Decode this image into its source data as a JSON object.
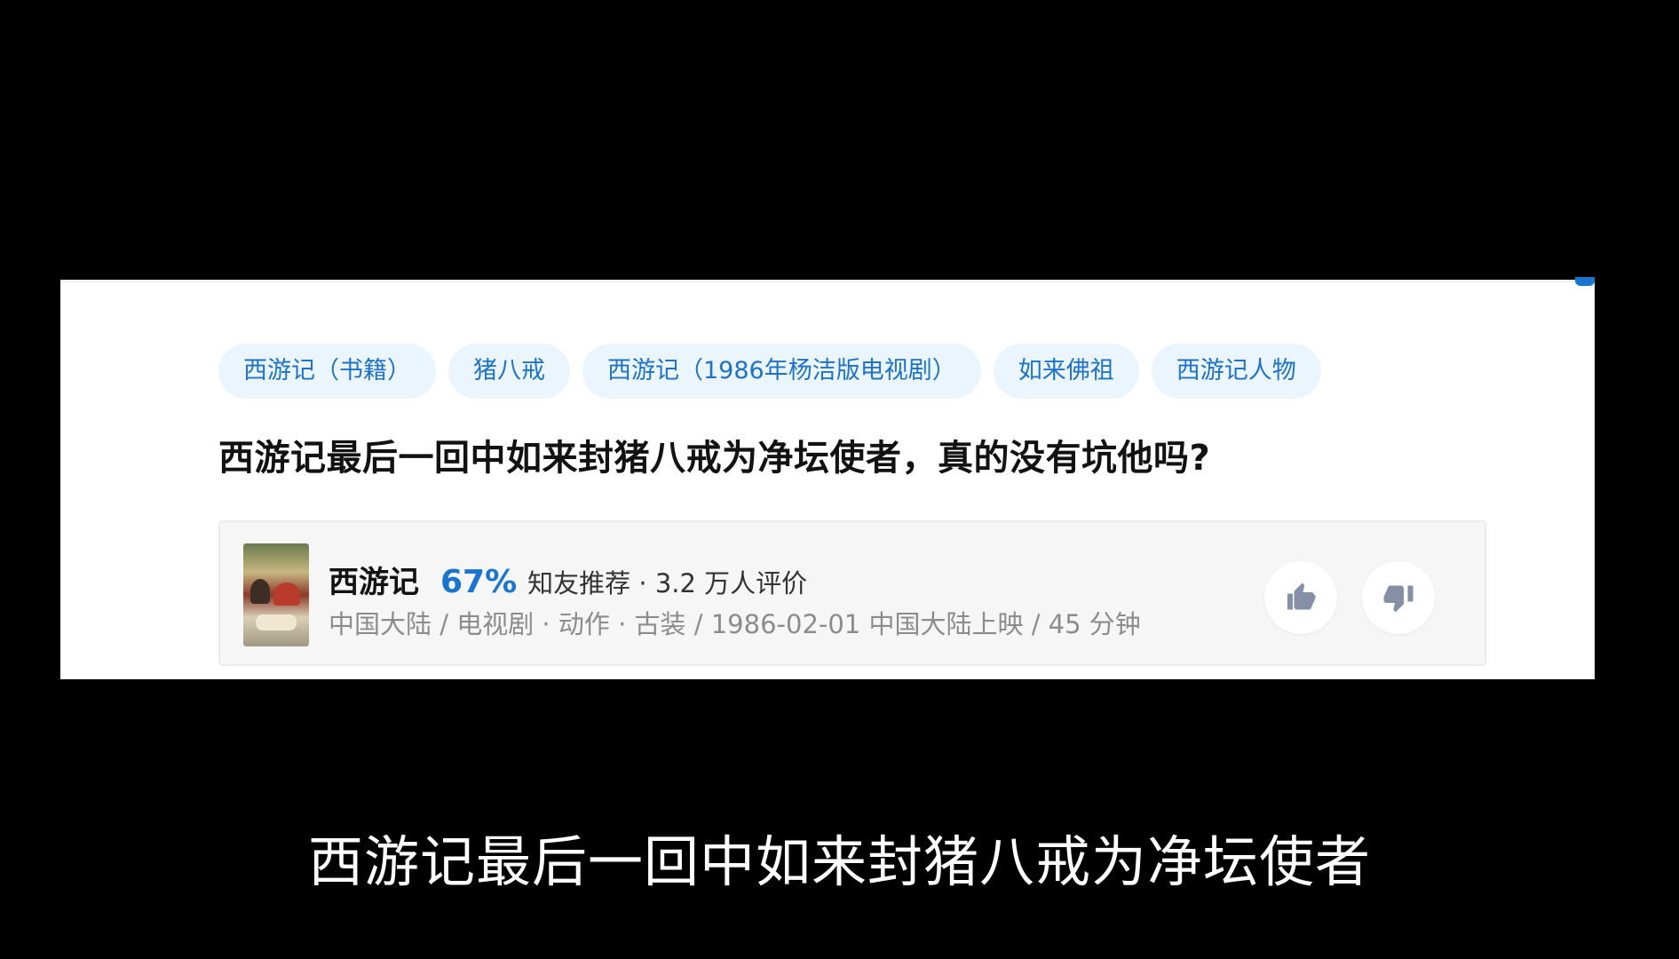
{
  "topics": [
    {
      "label": "西游记（书籍）"
    },
    {
      "label": "猪八戒"
    },
    {
      "label": "西游记（1986年杨洁版电视剧）"
    },
    {
      "label": "如来佛祖"
    },
    {
      "label": "西游记人物"
    }
  ],
  "question": {
    "title": "西游记最后一回中如来封猪八戒为净坛使者，真的没有坑他吗?"
  },
  "media_card": {
    "name": "西游记",
    "rating_percent": "67%",
    "rating_text": "知友推荐 · 3.2 万人评价",
    "meta": "中国大陆 / 电视剧 · 动作 · 古装 / 1986-02-01 中国大陆上映 / 45 分钟",
    "like_icon": "thumbs-up-icon",
    "dislike_icon": "thumbs-down-icon"
  },
  "subtitle": "西游记最后一回中如来封猪八戒为净坛使者",
  "colors": {
    "background": "#000000",
    "panel": "#ffffff",
    "tag_bg": "#ebf5fd",
    "tag_text": "#1e73c8",
    "accent": "#1a75d1",
    "muted_text": "#8c8c8c",
    "icon_gray": "#8590a6"
  }
}
